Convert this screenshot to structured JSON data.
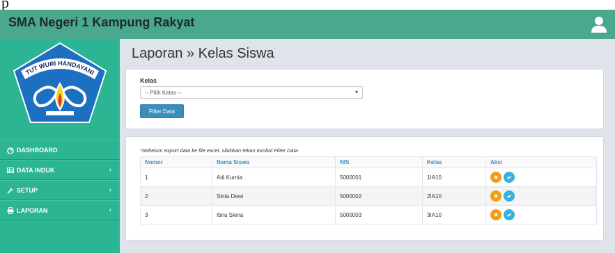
{
  "app": {
    "title": "SMA Negeri 1 Kampung Rakyat",
    "top_fragment": "p"
  },
  "logo": {
    "motto": "TUT WURI HANDAYANI"
  },
  "sidebar": {
    "items": [
      {
        "label": "DASHBOARD",
        "icon": "dashboard-icon",
        "has_arrow": false
      },
      {
        "label": "DATA INDUK",
        "icon": "table-icon",
        "has_arrow": true
      },
      {
        "label": "SETUP",
        "icon": "wrench-icon",
        "has_arrow": true
      },
      {
        "label": "LAPORAN",
        "icon": "print-icon",
        "has_arrow": true
      }
    ],
    "arrow": "‹"
  },
  "page": {
    "title": "Laporan » Kelas Siswa"
  },
  "filter": {
    "label": "Kelas",
    "select_value": "-- Pilih Kelas --",
    "button": "Filter Data"
  },
  "report": {
    "note": "*Sebelum export data ke file excel, silahkan tekan tombol Filter Data",
    "columns": [
      "Nomor",
      "Nama Siswa",
      "NIS",
      "Kelas",
      "Aksi"
    ],
    "rows": [
      [
        "1",
        "Adi Kurnia",
        "5000001",
        "1IA10"
      ],
      [
        "2",
        "Sinta Dewi",
        "5000002",
        "2IA10"
      ],
      [
        "3",
        "Ibnu Siena",
        "5000003",
        "3IA10"
      ]
    ]
  },
  "colors": {
    "header": "#4aa88f",
    "sidebar": "#2bb593",
    "content_bg": "#dfe4ea",
    "primary": "#3c8dbc",
    "delete": "#f39c12",
    "confirm": "#3ab0dc"
  }
}
